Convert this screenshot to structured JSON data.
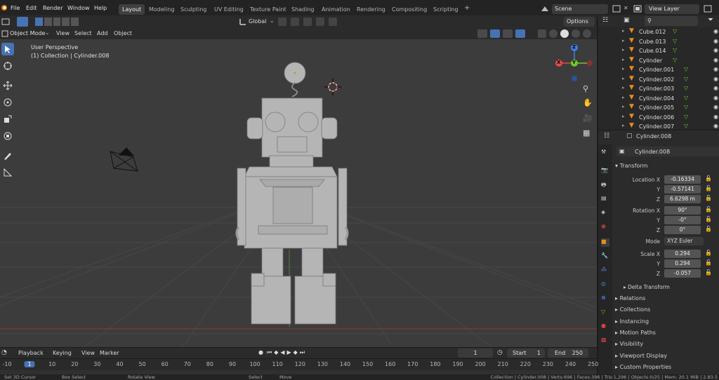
{
  "topbar": {
    "menus": [
      "File",
      "Edit",
      "Render",
      "Window",
      "Help"
    ],
    "workspaces": [
      "Layout",
      "Modeling",
      "Sculpting",
      "UV Editing",
      "Texture Paint",
      "Shading",
      "Animation",
      "Rendering",
      "Compositing",
      "Scripting"
    ],
    "add_tab": "+",
    "scene": "Scene",
    "view_layer": "View Layer"
  },
  "header": {
    "orientation": "Global",
    "options": "Options"
  },
  "viewport_header": {
    "mode": "Object Mode",
    "menus": [
      "View",
      "Select",
      "Add",
      "Object"
    ]
  },
  "viewport": {
    "perspective": "User Perspective",
    "collection": "(1) Collection | Cylinder.008",
    "gizmo": {
      "x": "X",
      "y": "Y",
      "z": "Z"
    },
    "colors": {
      "x": "#e34a4a",
      "y": "#6ec82c",
      "z": "#3f7fe0",
      "background": "#3c3c3c",
      "grid": "#474747",
      "robot": "#b5b5b5"
    }
  },
  "outliner": {
    "items": [
      "Cube.012",
      "Cube.013",
      "Cube.014",
      "Cylinder",
      "Cylinder.001",
      "Cylinder.002",
      "Cylinder.003",
      "Cylinder.004",
      "Cylinder.005",
      "Cylinder.006",
      "Cylinder.007"
    ]
  },
  "properties": {
    "object_name": "Cylinder.008",
    "data_name": "Cylinder.008",
    "transform": {
      "title": "Transform",
      "location_label": "Location X",
      "location": [
        "-0.16334",
        "-0.57141",
        "6.6298 m"
      ],
      "rotation_label": "Rotation X",
      "rotation": [
        "90°",
        "-0°",
        "0°"
      ],
      "mode_label": "Mode",
      "mode": "XYZ Euler",
      "scale_label": "Scale X",
      "scale": [
        "0.294",
        "0.294",
        "-0.057"
      ],
      "y": "Y",
      "z": "Z"
    },
    "sections": [
      "Delta Transform",
      "Relations",
      "Collections",
      "Instancing",
      "Motion Paths",
      "Visibility",
      "Viewport Display",
      "Custom Properties"
    ]
  },
  "timeline": {
    "menus": [
      "Playback",
      "Keying",
      "View",
      "Marker"
    ],
    "current_frame": "1",
    "start_label": "Start",
    "start": "1",
    "end_label": "End",
    "end": "250",
    "ticks": [
      "-10",
      "1",
      "10",
      "20",
      "30",
      "40",
      "50",
      "60",
      "70",
      "80",
      "90",
      "100",
      "110",
      "120",
      "130",
      "140",
      "150",
      "160",
      "170",
      "180",
      "190",
      "200",
      "210",
      "220",
      "230",
      "240",
      "250"
    ]
  },
  "statusbar": {
    "left": [
      "Set 3D Cursor",
      "Box Select",
      "Rotate View",
      "Select",
      "Move"
    ],
    "right": "Collection | Cylinder.008 | Verts:696 | Faces:396 | Tris:1,296 | Objects:0/25 | Mem: 20.1 MiB | 2.83.5"
  }
}
